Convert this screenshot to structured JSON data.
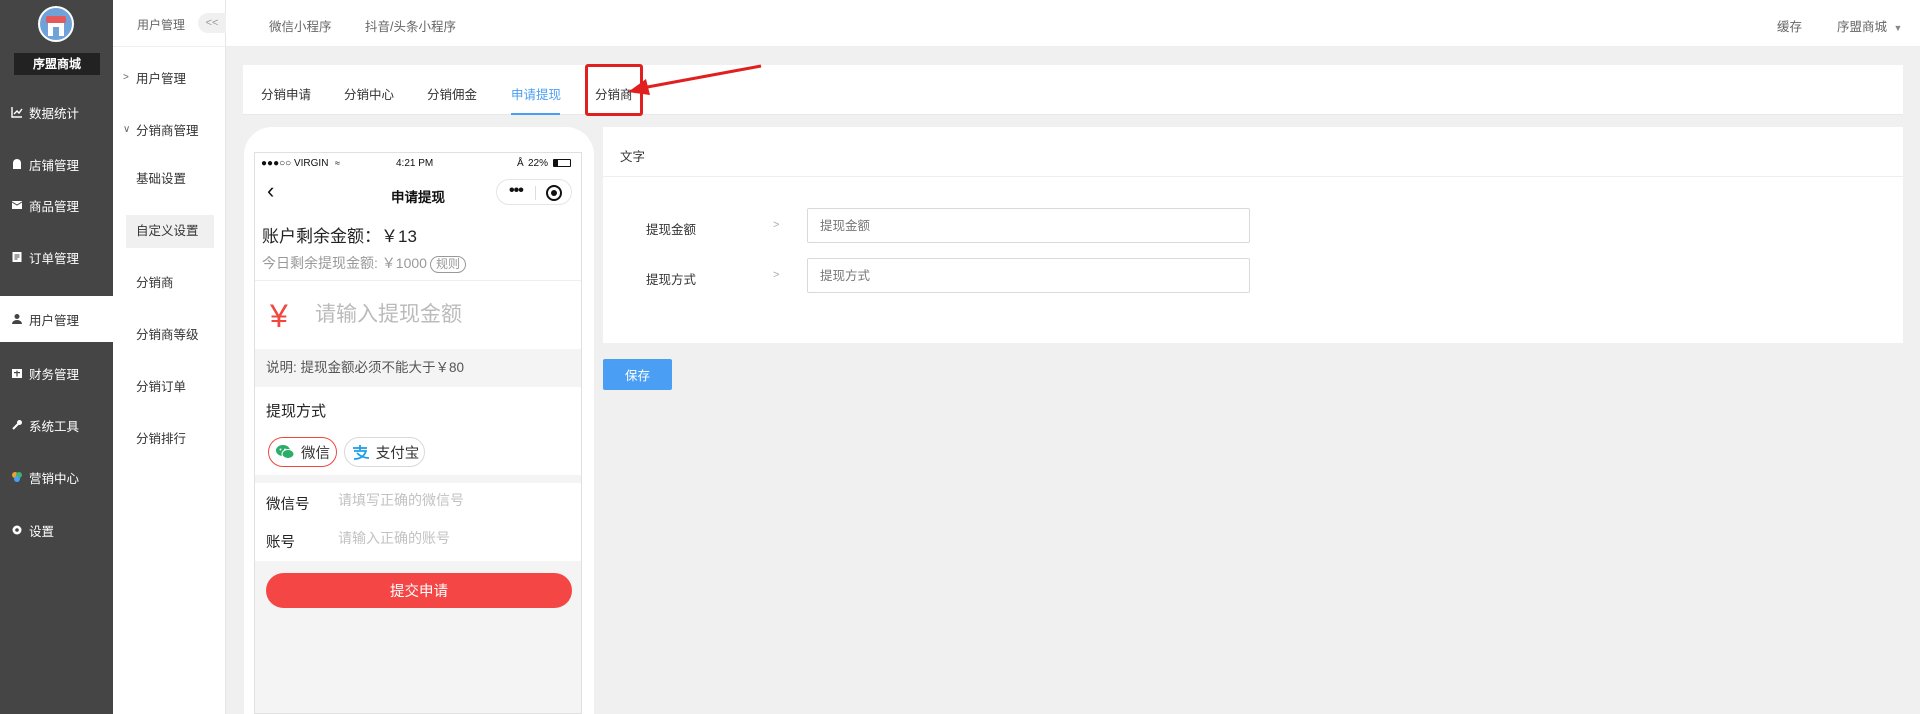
{
  "app": {
    "brand": "序盟商城"
  },
  "nav1": {
    "items": [
      {
        "label": "数据统计",
        "icon": "chart-icon"
      },
      {
        "label": "店铺管理",
        "icon": "shop-icon"
      },
      {
        "label": "商品管理",
        "icon": "goods-icon"
      },
      {
        "label": "订单管理",
        "icon": "order-icon"
      },
      {
        "label": "用户管理",
        "icon": "user-icon",
        "active": true
      },
      {
        "label": "财务管理",
        "icon": "finance-icon"
      },
      {
        "label": "系统工具",
        "icon": "wrench-icon"
      },
      {
        "label": "营销中心",
        "icon": "marketing-icon"
      },
      {
        "label": "设置",
        "icon": "gear-icon"
      }
    ]
  },
  "nav2": {
    "header": "用户管理",
    "collapse": "<<",
    "group1": "用户管理",
    "group2": "分销商管理",
    "items": [
      "基础设置",
      "自定义设置",
      "分销商",
      "分销商等级",
      "分销订单",
      "分销排行"
    ],
    "active_index": 1
  },
  "topbar": {
    "tabs": [
      "微信小程序",
      "抖音/头条小程序"
    ],
    "cache": "缓存",
    "user": "序盟商城",
    "user_icon": "chevron-down-icon"
  },
  "tabs": {
    "items": [
      "分销申请",
      "分销中心",
      "分销佣金",
      "申请提现",
      "分销商"
    ],
    "active_index": 3,
    "highlight_color": "#e21f1f"
  },
  "phone": {
    "status": {
      "carrier": "●●●○○ VIRGIN",
      "time": "4:21 PM",
      "battery": "22%"
    },
    "title": "申请提现",
    "balance": "账户剩余金额：￥13",
    "today": "今日剩余提现金额: ￥1000",
    "rule": "规则",
    "yen": "¥",
    "amount_placeholder": "请输入提现金额",
    "note": "说明:   提现金额必须不能大于￥80",
    "method_label": "提现方式",
    "wechat": "微信",
    "alipay": "支付宝",
    "wechat_no_label": "微信号",
    "wechat_no_placeholder": "请填写正确的微信号",
    "account_label": "账号",
    "account_placeholder": "请输入正确的账号",
    "submit": "提交申请",
    "accent": "#f54646"
  },
  "panel": {
    "section": "文字",
    "fields": [
      {
        "label": "提现金额",
        "placeholder": "提现金额"
      },
      {
        "label": "提现方式",
        "placeholder": "提现方式"
      }
    ],
    "save": "保存",
    "accent": "#4a9ff5"
  }
}
